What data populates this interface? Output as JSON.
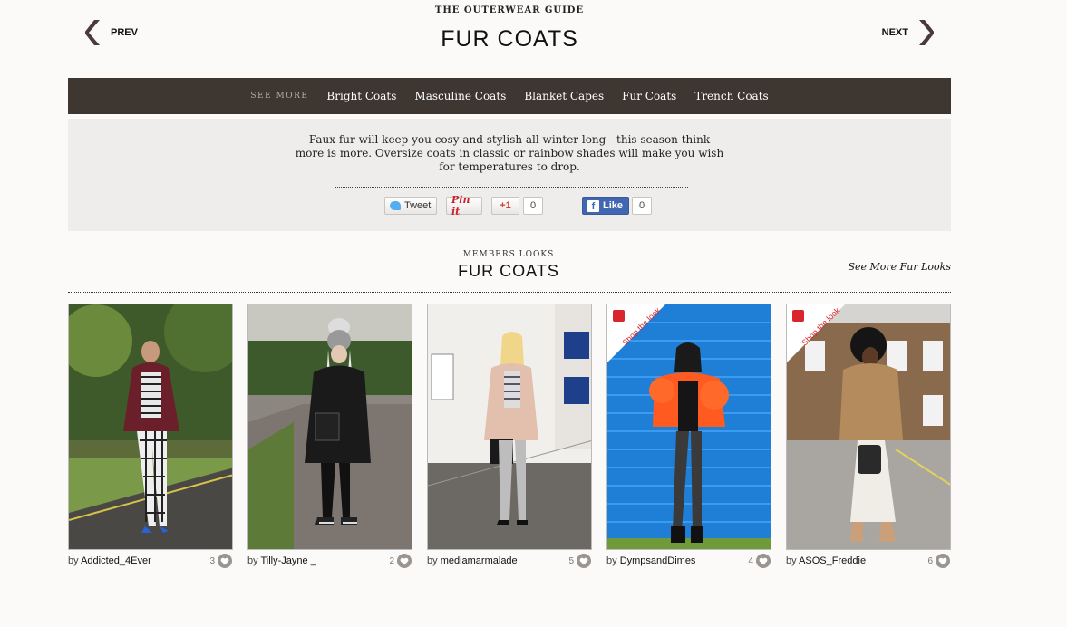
{
  "header": {
    "guide_label": "THE OUTERWEAR GUIDE",
    "title": "FUR COATS",
    "prev_label": "PREV",
    "next_label": "NEXT",
    "accent_color": "#4a3a40"
  },
  "see_more": {
    "label": "SEE MORE",
    "links": [
      {
        "label": "Bright Coats",
        "current": false
      },
      {
        "label": "Masculine Coats",
        "current": false
      },
      {
        "label": "Blanket Capes",
        "current": false
      },
      {
        "label": "Fur Coats",
        "current": true
      },
      {
        "label": "Trench Coats",
        "current": false
      }
    ]
  },
  "intro": {
    "text": "Faux fur will keep you cosy and stylish all winter long - this season think more is more. Oversize coats in classic or rainbow shades will make you wish for temperatures to drop."
  },
  "share": {
    "tweet_label": "Tweet",
    "pin_label": "Pin it",
    "gplus_label": "+1",
    "gplus_count": "0",
    "fb_label": "Like",
    "fb_count": "0"
  },
  "members": {
    "label": "MEMBERS LOOKS",
    "title": "FUR COATS",
    "see_more_label": "See More Fur Looks"
  },
  "looks": [
    {
      "by": "by",
      "author": "Addicted_4Ever",
      "count": "3",
      "shop_the_look": false
    },
    {
      "by": "by",
      "author": "Tilly-Jayne _",
      "count": "2",
      "shop_the_look": false
    },
    {
      "by": "by",
      "author": "mediamarmalade",
      "count": "5",
      "shop_the_look": false
    },
    {
      "by": "by",
      "author": "DympsandDimes",
      "count": "4",
      "shop_the_look": true,
      "shop_label": "Shop the look"
    },
    {
      "by": "by",
      "author": "ASOS_Freddie",
      "count": "6",
      "shop_the_look": true,
      "shop_label": "Shop the look"
    }
  ]
}
